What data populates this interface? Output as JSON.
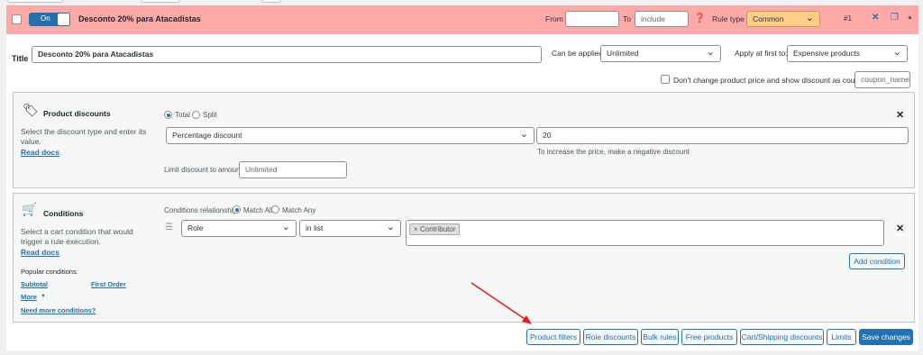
{
  "rule": {
    "enabled_label": "On",
    "title": "Desconto 20% para Atacadistas",
    "from_label": "From",
    "from_value": "",
    "to_label": "To",
    "to_placeholder": "include",
    "rule_type_label": "Rule type",
    "rule_type_value": "Common",
    "rule_number": "#1"
  },
  "settings": {
    "title_label": "Title",
    "title_value": "Desconto 20% para Atacadistas",
    "can_be_applied_label": "Can be applied",
    "can_be_applied_value": "Unlimited",
    "apply_first_label": "Apply at first to:",
    "apply_first_value": "Expensive products",
    "coupon_checkbox_label": "Don't change product price and show discount as coupon",
    "coupon_placeholder": "coupon_name"
  },
  "product_discounts": {
    "title": "Product discounts",
    "description": "Select the discount type and enter its value.",
    "read_docs": "Read docs",
    "radio_total": "Total",
    "radio_split": "Split",
    "type_value": "Percentage discount",
    "amount_value": "20",
    "hint": "To increase the price, make a negative discount",
    "limit_label": "Limit discount to amount",
    "limit_placeholder": "Unlimited"
  },
  "conditions": {
    "title": "Conditions",
    "description": "Select a cart condition that would trigger a rule execution.",
    "read_docs": "Read docs",
    "relationship_label": "Conditions relationship",
    "match_all": "Match All",
    "match_any": "Match Any",
    "field_value": "Role",
    "operator_value": "in list",
    "tag_value": "Contributor",
    "tag_remove": "×",
    "add_button": "Add condition",
    "popular_label": "Popular conditions:",
    "subtotal": "Subtotal",
    "first_order": "First Order",
    "more": "More",
    "need_more": "Need more conditions?"
  },
  "footer_buttons": [
    "Product filters",
    "Role discounts",
    "Bulk rules",
    "Free products",
    "Cart/Shipping discounts",
    "Limits"
  ],
  "save_button": "Save changes",
  "colors": {
    "rule_bar": "#ffaaa8",
    "accent": "#2271b1",
    "rule_type_bg": "#ffce87",
    "arrow": "#e02020"
  }
}
